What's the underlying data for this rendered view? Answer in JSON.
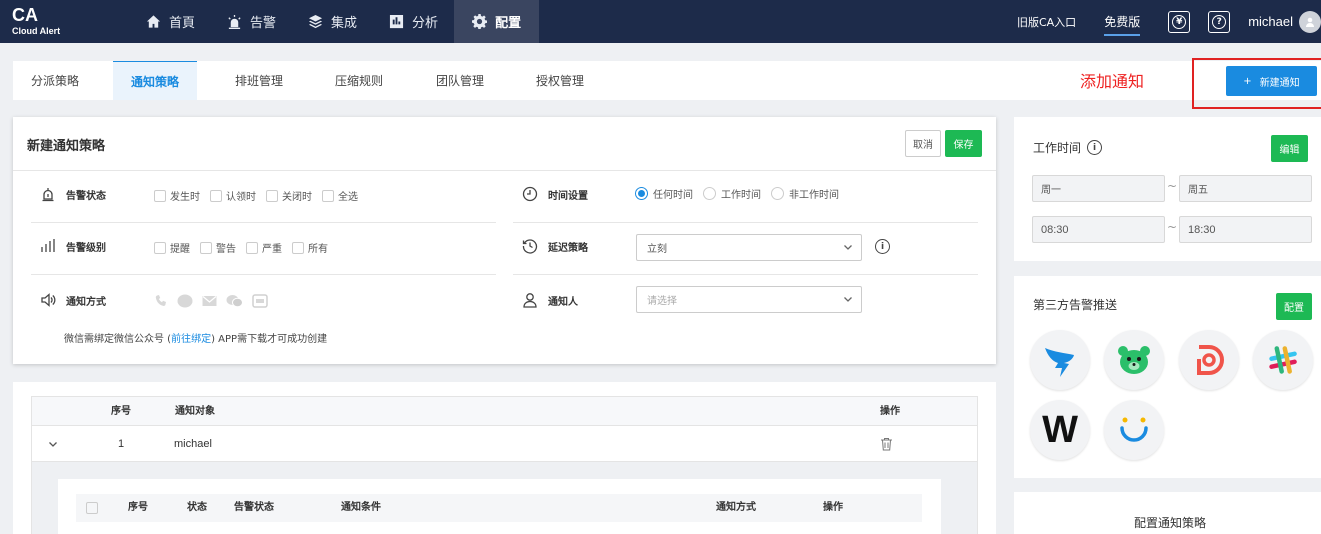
{
  "brand": {
    "name": "CA",
    "subtitle": "Cloud Alert"
  },
  "nav": [
    {
      "label": "首頁",
      "icon": "home-icon"
    },
    {
      "label": "告警",
      "icon": "alarm-icon"
    },
    {
      "label": "集成",
      "icon": "layers-icon"
    },
    {
      "label": "分析",
      "icon": "chart-icon"
    },
    {
      "label": "配置",
      "icon": "gear-icon",
      "active": true
    }
  ],
  "header": {
    "old_version": "旧版CA入口",
    "free_plan": "免费版",
    "yen_symbol": "¥",
    "help_symbol": "?",
    "username": "michael"
  },
  "tabs": [
    {
      "label": "分派策略"
    },
    {
      "label": "通知策略",
      "active": true
    },
    {
      "label": "排班管理"
    },
    {
      "label": "压缩规则"
    },
    {
      "label": "团队管理"
    },
    {
      "label": "授权管理"
    }
  ],
  "annotation": "添加通知",
  "new_button": {
    "plus": "+",
    "label": "新建通知"
  },
  "form": {
    "title": "新建通知策略",
    "cancel": "取消",
    "save": "保存",
    "alert_status": {
      "label": "告警状态",
      "options": [
        "发生时",
        "认领时",
        "关闭时",
        "全选"
      ]
    },
    "time_setting": {
      "label": "时间设置",
      "options": [
        "任何时间",
        "工作时间",
        "非工作时间"
      ],
      "selected": "任何时间"
    },
    "alert_level": {
      "label": "告警级别",
      "options": [
        "提醒",
        "警告",
        "严重",
        "所有"
      ]
    },
    "delay": {
      "label": "延迟策略",
      "value": "立刻",
      "info": "i"
    },
    "notify_method": {
      "label": "通知方式",
      "channels": [
        "phone-icon",
        "sms-icon",
        "email-icon",
        "wechat-icon",
        "app-icon"
      ]
    },
    "notify_person": {
      "label": "通知人",
      "placeholder": "请选择"
    },
    "note_prefix": "微信需绑定微信公众号 (",
    "note_link": "前往绑定",
    "note_suffix": ") APP需下载才可成功创建"
  },
  "table": {
    "headers": {
      "index": "序号",
      "target": "通知对象",
      "action": "操作"
    },
    "rows": [
      {
        "index": "1",
        "target": "michael"
      }
    ],
    "sub_headers": {
      "index": "序号",
      "status": "状态",
      "alert_status": "告警状态",
      "condition": "通知条件",
      "method": "通知方式",
      "action": "操作"
    }
  },
  "work_time": {
    "title": "工作时间",
    "info": "i",
    "edit": "编辑",
    "day_start": "周一",
    "day_end": "周五",
    "time_start": "08:30",
    "time_end": "18:30",
    "separator": "~"
  },
  "third_party": {
    "title": "第三方告警推送",
    "config": "配置",
    "integrations": [
      "dingtalk-icon",
      "bear-icon",
      "d-logo-icon",
      "slack-icon",
      "w-logo-icon",
      "smile-icon"
    ],
    "w_letter": "W"
  },
  "config_policy": {
    "title": "配置通知策略"
  },
  "colors": {
    "topbar": "#1d2b4a",
    "primary": "#1a8be0",
    "success": "#1db954",
    "annotation": "#e02222"
  }
}
